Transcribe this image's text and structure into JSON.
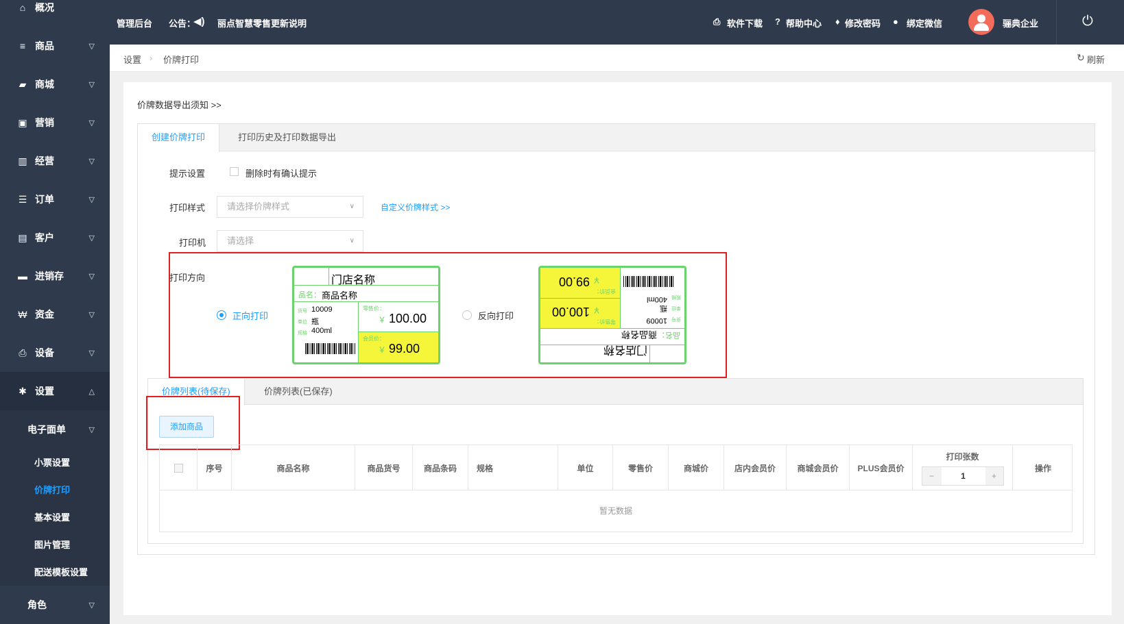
{
  "sidebar": {
    "items": [
      {
        "icon": "home-icon",
        "glyph": "⌂",
        "label": "概况"
      },
      {
        "icon": "list-icon",
        "glyph": "≡",
        "label": "商品"
      },
      {
        "icon": "shop-icon",
        "glyph": "▰",
        "label": "商城"
      },
      {
        "icon": "gift-icon",
        "glyph": "▣",
        "label": "营销"
      },
      {
        "icon": "chart-icon",
        "glyph": "▥",
        "label": "经营"
      },
      {
        "icon": "order-icon",
        "glyph": "☰",
        "label": "订单"
      },
      {
        "icon": "customer-icon",
        "glyph": "▤",
        "label": "客户"
      },
      {
        "icon": "truck-icon",
        "glyph": "▬",
        "label": "进销存"
      },
      {
        "icon": "money-icon",
        "glyph": "₩",
        "label": "资金"
      },
      {
        "icon": "printer-icon",
        "glyph": "⎙",
        "label": "设备"
      },
      {
        "icon": "gear-icon",
        "glyph": "✱",
        "label": "设置"
      }
    ],
    "sub_group": "电子面单",
    "sub_items": [
      "小票设置",
      "价牌打印",
      "基本设置",
      "图片管理",
      "配送模板设置"
    ],
    "last_group": "角色"
  },
  "topbar": {
    "admin": "管理后台",
    "notice_label": "公告：",
    "notice_text": "丽点智慧零售更新说明",
    "links": [
      "软件下载",
      "帮助中心",
      "修改密码",
      "绑定微信"
    ],
    "company": "骊典企业"
  },
  "breadcrumb": {
    "root": "设置",
    "current": "价牌打印",
    "refresh": "刷新"
  },
  "page": {
    "export_notice": "价牌数据导出须知 >>",
    "tabs": [
      "创建价牌打印",
      "打印历史及打印数据导出"
    ],
    "hint_label": "提示设置",
    "hint_checkbox": "删除时有确认提示",
    "style_label": "打印样式",
    "style_placeholder": "请选择价牌样式",
    "custom_style_link": "自定义价牌样式 >>",
    "printer_label": "打印机",
    "printer_placeholder": "请选择",
    "direction_label": "打印方向",
    "forward_label": "正向打印",
    "reverse_label": "反向打印"
  },
  "label_preview": {
    "store": "门店名称",
    "name_key": "品名：",
    "name": "商品名称",
    "code_key": "货号",
    "code": "10009",
    "unit_key": "单位",
    "unit": "瓶",
    "spec_key": "规格",
    "spec": "400ml",
    "retail_key": "零售价：",
    "retail": "100.00",
    "member_key": "会员价：",
    "member": "99.00",
    "currency": "￥"
  },
  "list": {
    "tabs": [
      "价牌列表(待保存)",
      "价牌列表(已保存)"
    ],
    "add_button": "添加商品",
    "columns": [
      "序号",
      "商品名称",
      "商品货号",
      "商品条码",
      "规格",
      "单位",
      "零售价",
      "商城价",
      "店内会员价",
      "商城会员价",
      "PLUS会员价",
      "打印张数",
      "操作"
    ],
    "copies": "1",
    "empty": "暂无数据"
  },
  "colors": {
    "sidebar": "#2f3a4c",
    "accent": "#1e9fff",
    "highlight": "#e02020",
    "label_green": "#6bd36b",
    "label_yellow": "#f5f53a"
  }
}
